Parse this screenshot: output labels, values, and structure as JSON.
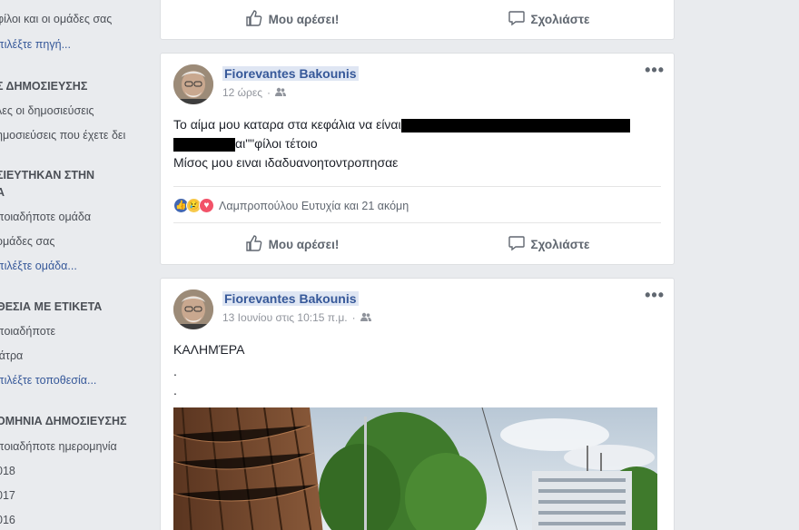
{
  "sidebar": {
    "items": [
      {
        "text": "φίλοι και οι ομάδες σας",
        "kind": "text"
      },
      {
        "text": "πιλέξτε πηγή...",
        "kind": "link"
      },
      {
        "text": "Σ ΔΗΜΟΣΙΕΥΣΗΣ",
        "kind": "head"
      },
      {
        "text": "λες οι δημοσιεύσεις",
        "kind": "text"
      },
      {
        "text": "ημοσιεύσεις που έχετε δει",
        "kind": "text"
      },
      {
        "text": "ΣΙΕΥΤΗΚΑΝ ΣΤΗΝ",
        "kind": "head"
      },
      {
        "text": "Α",
        "kind": "head"
      },
      {
        "text": "ποιαδήποτε ομάδα",
        "kind": "text"
      },
      {
        "text": "ομάδες σας",
        "kind": "text"
      },
      {
        "text": "πιλέξτε ομάδα...",
        "kind": "link"
      },
      {
        "text": "ΘΕΣΙΑ ΜΕ ΕΤΙΚΕΤΑ",
        "kind": "head"
      },
      {
        "text": "ποιαδήποτε",
        "kind": "text"
      },
      {
        "text": "ιάτρα",
        "kind": "text"
      },
      {
        "text": "πιλέξτε τοποθεσία...",
        "kind": "link"
      },
      {
        "text": "ΟΜΗΝΙΑ ΔΗΜΟΣΙΕΥΣΗΣ",
        "kind": "head"
      },
      {
        "text": "ποιαδήποτε ημερομηνία",
        "kind": "text"
      },
      {
        "text": "018",
        "kind": "text"
      },
      {
        "text": "017",
        "kind": "text"
      },
      {
        "text": "016",
        "kind": "text"
      }
    ]
  },
  "actions": {
    "like_label": "Μου αρέσει!",
    "comment_label": "Σχολιάστε"
  },
  "post1": {
    "author": "Fiorevantes Bakounis",
    "time": "12 ώρες",
    "line1": "Το αίμα μου καταρα στα κεφάλια να είναι",
    "line2_after_redact": "αι\"\"φίλοι τέτοιο",
    "line3": "Μίσος μου ειναι ιδαδυανοητοντροπησαε",
    "reactions_text": "Λαμπροπούλου Ευτυχία και 21 ακόμη",
    "more": "•••"
  },
  "post2": {
    "author": "Fiorevantes Bakounis",
    "time": "13 Ιουνίου στις 10:15 π.μ.",
    "line1": "ΚΑΛΗΜΈΡΑ",
    "line2": ".",
    "line3": ".",
    "more": "•••"
  },
  "colors": {
    "link": "#365899",
    "background": "#e9ebee",
    "like_blue": "#4267b2",
    "love_red": "#f25268",
    "sad_yellow": "#f7c94b"
  }
}
